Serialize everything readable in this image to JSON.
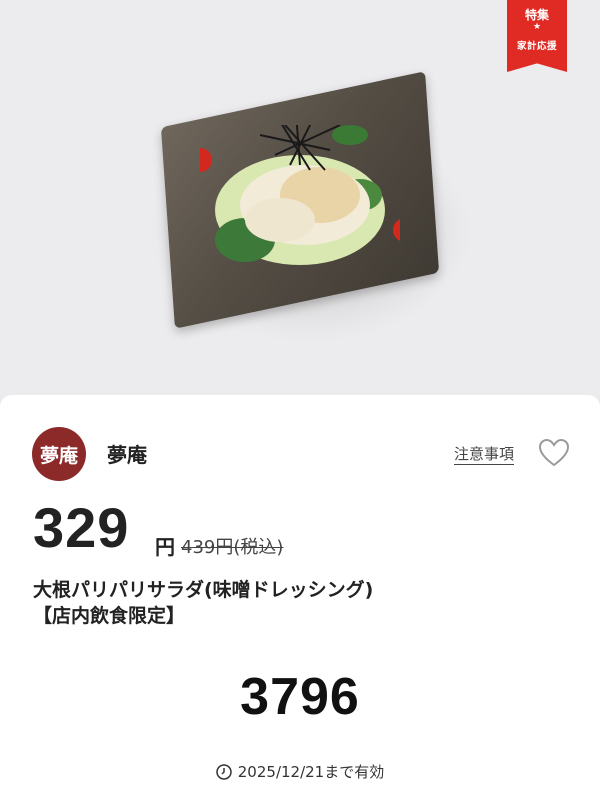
{
  "badge": {
    "line1": "特集",
    "line2": "★",
    "line3": "家計応援"
  },
  "shop": {
    "logo_text": "夢庵",
    "name": "夢庵",
    "notice_link": "注意事項"
  },
  "price": {
    "amount": "329",
    "unit": "円",
    "original": "439円(税込)"
  },
  "item": {
    "title_line1": "大根パリパリサラダ(味噌ドレッシング)",
    "title_line2": "【店内飲食限定】"
  },
  "coupon_code": "3796",
  "validity": "2025/12/21まで有効",
  "colors": {
    "badge_red": "#e02a24",
    "logo_maroon": "#8c2a2a",
    "background": "#ececee"
  },
  "icons": [
    "heart-icon",
    "clock-icon"
  ]
}
